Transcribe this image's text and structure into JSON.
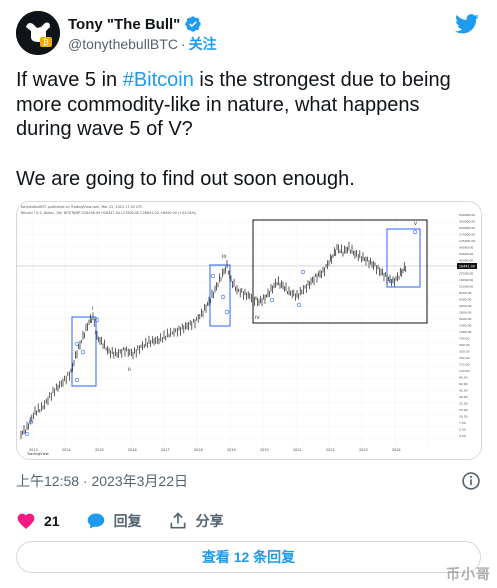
{
  "author": {
    "display_name": "Tony \"The Bull\"",
    "handle": "@tonythebullBTC",
    "separator": "·",
    "follow_label": "关注",
    "avatar_icon": "bull-avatar-icon",
    "verified_icon": "verified-badge-icon"
  },
  "brand": {
    "logo_icon": "twitter-bird-icon",
    "color": "#1d9bf0"
  },
  "tweet": {
    "line1_pre": "If wave 5 in ",
    "hashtag": "#Bitcoin",
    "line1_post": " is the strongest due to being",
    "line2": "more commodity-like in nature, what happens",
    "line3": "during wave 5 of V?",
    "line4": "We are going to find out soon enough."
  },
  "media": {
    "header_text": "tonythebullBTC published on TradingView.com, Mar 22, 2023 17:02 UTC",
    "subheader_text": "Bitcoin / U.S. Dollar, 1W, BITSTAMP  O26198.00  H28447.00  L27800.00  C28641.00  +8449.00 (+43.04%)",
    "wave_labels": [
      "I",
      "II",
      "III",
      "IV",
      "V"
    ],
    "x_tick_labels": [
      "2013",
      "2014",
      "2015",
      "2016",
      "2017",
      "2018",
      "2019",
      "2020",
      "2021",
      "2022",
      "2023",
      "2024"
    ],
    "y_tick_labels": [
      "500000.00",
      "350000.00",
      "250000.00",
      "175000.00",
      "125000.00",
      "90000.00",
      "64000.00",
      "45000.00",
      "32000.00",
      "22500.00",
      "16000.00",
      "11000.00",
      "8000.00",
      "5500.00",
      "4000.00",
      "2800.00",
      "2000.00",
      "1400.00",
      "1000.00",
      "700.00",
      "500.00",
      "350.00",
      "250.00",
      "170.00",
      "120.00",
      "85.00",
      "60.00",
      "42.00",
      "30.00",
      "21.00",
      "15.00",
      "10.50",
      "7.50",
      "5.00",
      "3.50"
    ],
    "price_label": "28441.00",
    "footer_logo_text": "TradingView"
  },
  "timestamp": "上午12:58 · 2023年3月22日",
  "actions": {
    "like_count": "21",
    "reply_label": "回复",
    "share_label": "分享"
  },
  "replies_button_label": "查看 12 条回复",
  "watermark": "币小哥"
}
